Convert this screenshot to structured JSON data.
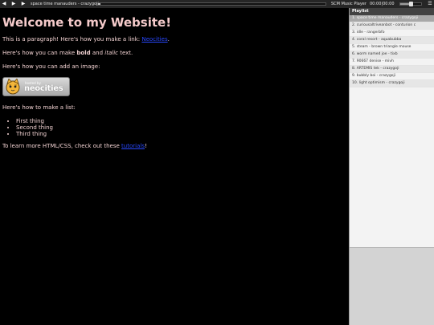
{
  "player": {
    "prev_icon": "◀",
    "play_icon": "▶",
    "next_icon": "▶",
    "now_playing": "space time manauders - crazygoji",
    "progress": 0.01,
    "name": "SCM Music Player",
    "time": "00:00|00:00",
    "volume": 0.55,
    "menu_icon": "☰"
  },
  "page": {
    "heading": "Welcome to my Website!",
    "p1_text": "This is a paragraph! Here's how you make a link: ",
    "p1_link": "Neocities",
    "p1_end": ".",
    "p2_start": "Here's how you can make ",
    "p2_bold": "bold",
    "p2_mid": " and ",
    "p2_italic": "italic",
    "p2_end": " text.",
    "p3": "Here's how you can add an image:",
    "badge": {
      "hosted": "hosted by",
      "brand": "neocities"
    },
    "p4": "Here's how to make a list:",
    "list": [
      "First thing",
      "Second thing",
      "Third thing"
    ],
    "p5_text": "To learn more HTML/CSS, check out these ",
    "p5_link": "tutorials",
    "p5_end": "!"
  },
  "playlist": {
    "title": "Playlist",
    "items": [
      "1. space time manauders - crazygoji",
      "2. curiousaltriveanbot - conturion c",
      "3. idle - rangerbfo",
      "4. coral resort - aquabubba",
      "5. steam - brown triangle mouse",
      "6. worm named joe - tixb",
      "7. 90667 denise - mivh",
      "8. ARTEMIS tek - crazygoji",
      "9. bubbly boi - crazygoji",
      "10. light optimism - crazygoji"
    ]
  },
  "colors": {
    "background": "#000000",
    "text": "#f2d2d2",
    "link": "#2848ff",
    "playlist_active": "#a8a8a8"
  }
}
